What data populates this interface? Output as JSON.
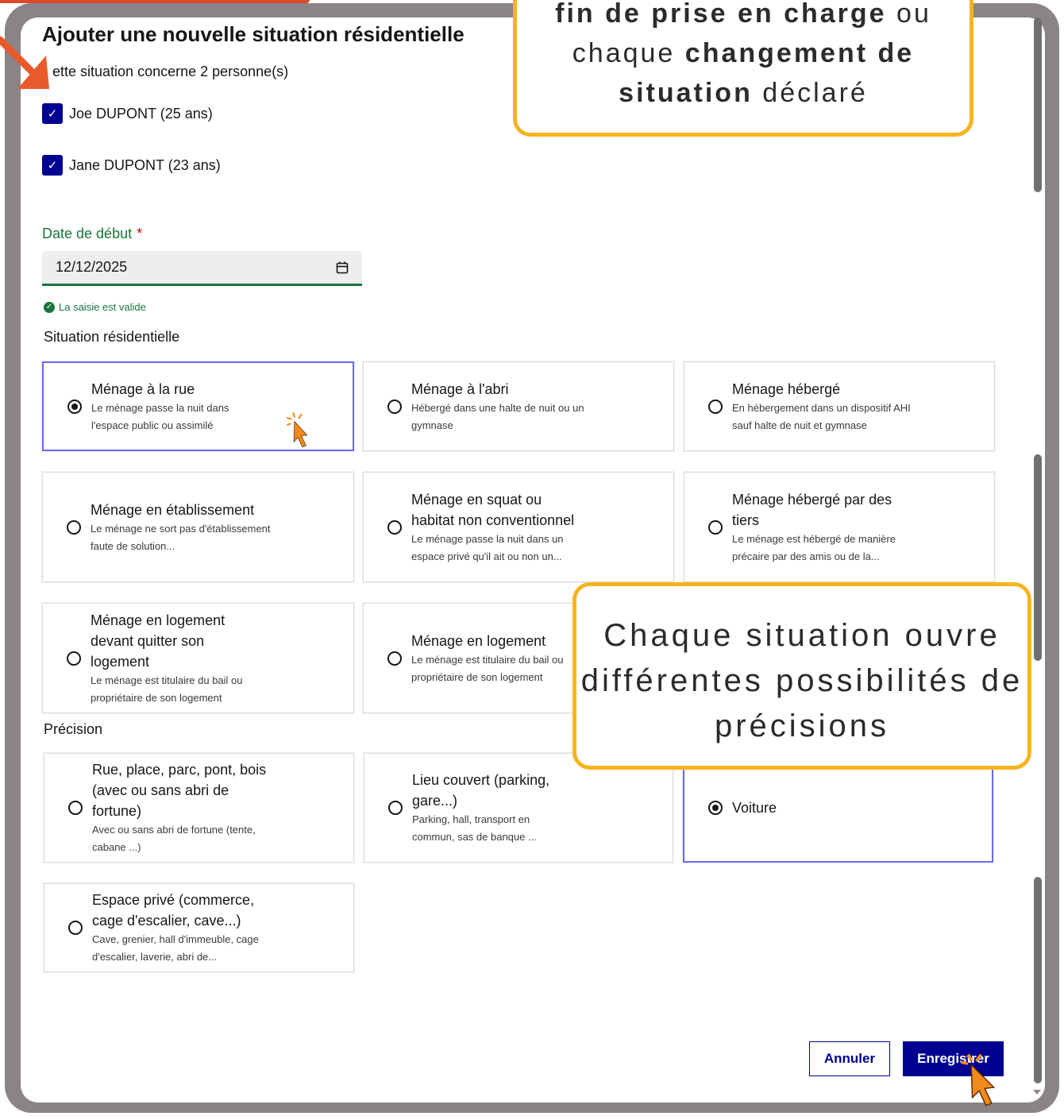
{
  "dialog": {
    "title": "Ajouter une nouvelle situation résidentielle",
    "subtitle": "ette situation concerne 2 personne(s)",
    "persons": [
      {
        "label": "Joe DUPONT (25 ans)",
        "checked": true
      },
      {
        "label": "Jane DUPONT (23 ans)",
        "checked": true
      }
    ],
    "date": {
      "label": "Date de début",
      "required_mark": "*",
      "value": "12/12/2025",
      "valid_message": "La saisie est valide"
    },
    "situation_label": "Situation résidentielle",
    "situations": [
      {
        "title": "Ménage à la rue",
        "desc": "Le ménage passe la nuit dans l'espace public ou assimilé",
        "selected": true
      },
      {
        "title": "Ménage à l'abri",
        "desc": "Hébergé dans une halte de nuit ou un gymnase",
        "selected": false
      },
      {
        "title": "Ménage hébergé",
        "desc": "En hébergement dans un dispositif AHI sauf halte de nuit et gymnase",
        "selected": false
      },
      {
        "title": "Ménage en établissement",
        "desc": "Le ménage ne sort pas d'établissement faute de solution...",
        "selected": false
      },
      {
        "title": "Ménage en squat ou habitat non conventionnel",
        "desc": "Le ménage passe la nuit dans un espace privé qu'il ait ou non un...",
        "selected": false
      },
      {
        "title": "Ménage hébergé par des tiers",
        "desc": "Le ménage est hébergé de manière précaire par des amis ou de la...",
        "selected": false
      },
      {
        "title": "Ménage en logement devant quitter son logement",
        "desc": "Le ménage est titulaire du bail ou propriétaire de son logement",
        "selected": false
      },
      {
        "title": "Ménage en logement",
        "desc": "Le ménage est titulaire du bail ou propriétaire de son logement",
        "selected": false
      }
    ],
    "precision_label": "Précision",
    "precisions": [
      {
        "title": "Rue, place, parc, pont, bois (avec ou sans abri de fortune)",
        "desc": "Avec ou sans abri de fortune (tente, cabane ...)",
        "selected": false
      },
      {
        "title": "Lieu couvert (parking, gare...)",
        "desc": "Parking, hall, transport en commun, sas de banque ...",
        "selected": false
      },
      {
        "title": "Voiture",
        "desc": "",
        "selected": true
      },
      {
        "title": "Espace privé (commerce, cage d'escalier, cave...)",
        "desc": "Cave, grenier, hall d'immeuble, cage d'escalier, laverie, abri de...",
        "selected": false
      }
    ],
    "buttons": {
      "cancel": "Annuler",
      "save": "Enregistrer"
    }
  },
  "callouts": {
    "top_part1": "fin de prise en charge",
    "top_part2": " ou",
    "top_part3": "chaque ",
    "top_part4": "changement de",
    "top_part5": "situation",
    "top_part6": " déclaré",
    "middle": "Chaque situation ouvre différentes possibilités de précisions"
  },
  "colors": {
    "primary": "#000091",
    "valid_green": "#18753c",
    "selected_border": "#6a6af4",
    "callout_border": "#f5b51f",
    "frame": "#8a8487",
    "cursor": "#f18a1b",
    "accent_arrow": "#e85a2b"
  }
}
